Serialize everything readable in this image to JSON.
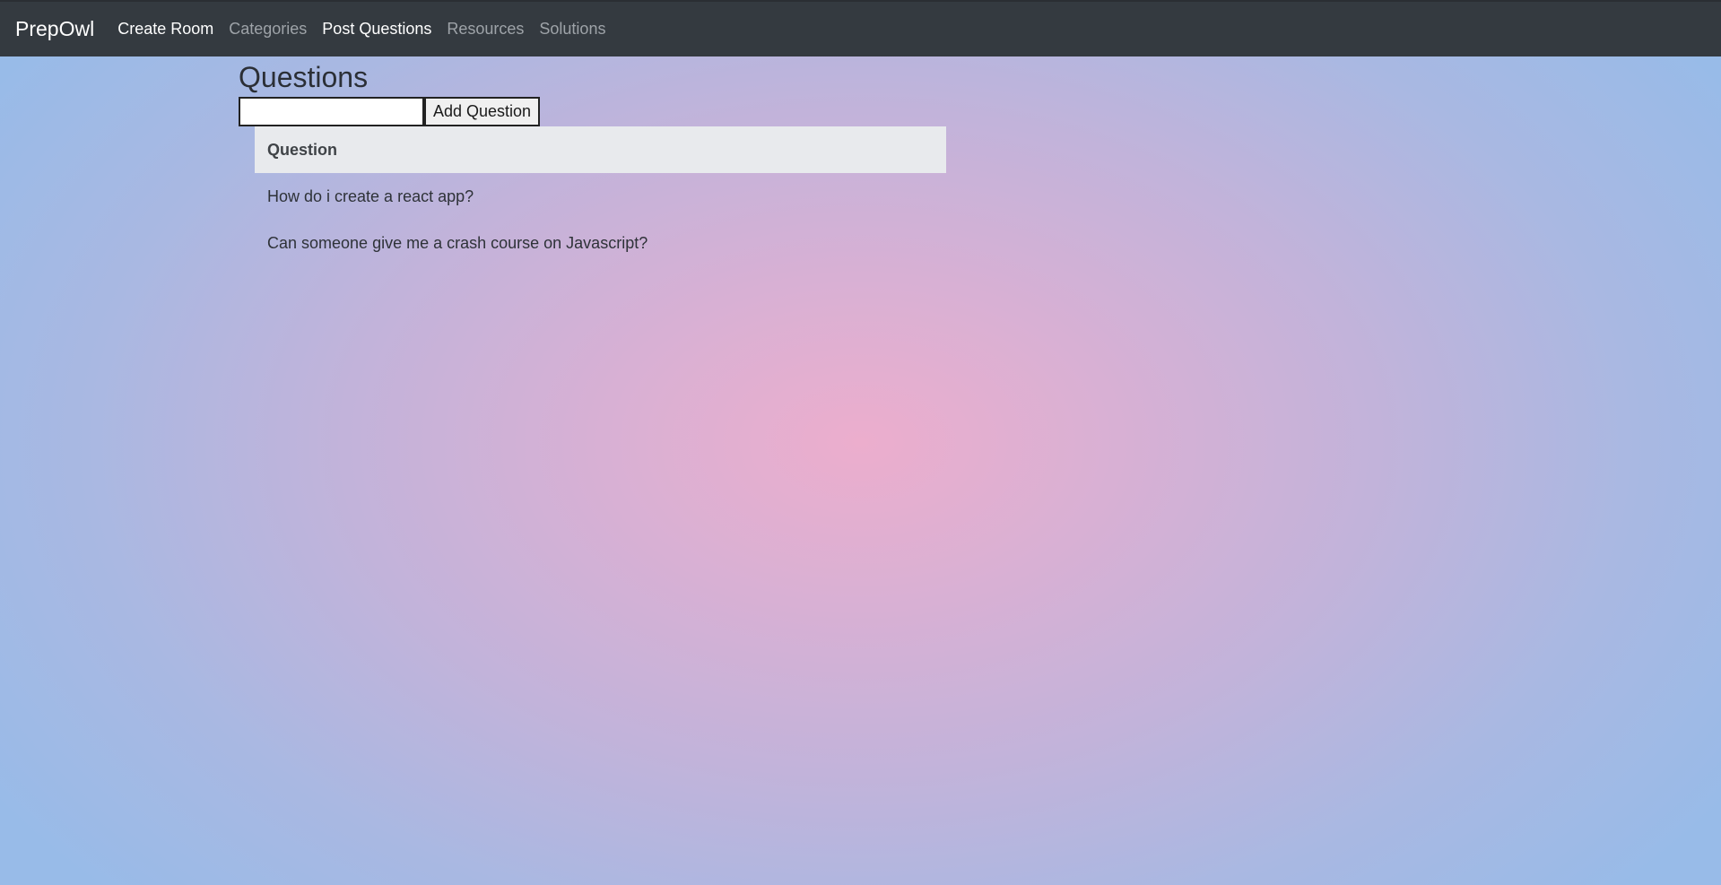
{
  "navbar": {
    "brand": "PrepOwl",
    "links": [
      {
        "label": "Create Room"
      },
      {
        "label": "Categories"
      },
      {
        "label": "Post Questions"
      },
      {
        "label": "Resources"
      },
      {
        "label": "Solutions"
      }
    ]
  },
  "main": {
    "title": "Questions",
    "input_value": "",
    "add_button_label": "Add Question",
    "table": {
      "header": "Question",
      "rows": [
        {
          "question": "How do i create a react app?"
        },
        {
          "question": "Can someone give me a crash course on Javascript?"
        }
      ]
    }
  },
  "colors": {
    "navbar_bg": "#343a40",
    "gradient_center": "#ecaecd",
    "gradient_edge": "#98bbe8",
    "table_header_bg": "#e8eaed"
  }
}
